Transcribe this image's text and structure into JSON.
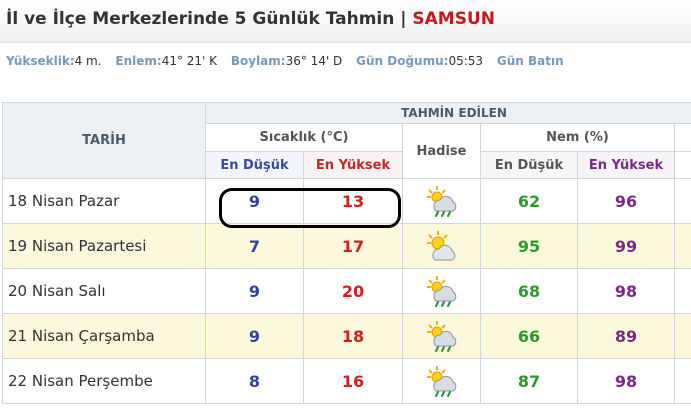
{
  "header": {
    "title": "İl ve İlçe Merkezlerinde 5 Günlük Tahmin |",
    "city": "SAMSUN"
  },
  "info": {
    "elevation_label": "Yükseklik:",
    "elevation_value": "4 m.",
    "lat_label": "Enlem:",
    "lat_value": "41° 21' K",
    "lon_label": "Boylam:",
    "lon_value": "36° 14' D",
    "sunrise_label": "Gün Doğumu:",
    "sunrise_value": "05:53",
    "sunset_label": "Gün Batın"
  },
  "table": {
    "date_header": "TARİH",
    "forecast_header": "TAHMİN EDİLEN",
    "temp_header": "Sıcaklık (°C)",
    "event_header": "Hadise",
    "humidity_header": "Nem (%)",
    "low_header": "En Düşük",
    "high_header": "En Yüksek",
    "hum_low_header": "En Düşük",
    "hum_high_header": "En Yüksek",
    "rows": [
      {
        "date": "18 Nisan Pazar",
        "temp_low": "9",
        "temp_high": "13",
        "icon": "cloud-sun-rain-icon",
        "hum_low": "62",
        "hum_high": "96"
      },
      {
        "date": "19 Nisan Pazartesi",
        "temp_low": "7",
        "temp_high": "17",
        "icon": "partly-cloudy-icon",
        "hum_low": "95",
        "hum_high": "99"
      },
      {
        "date": "20 Nisan Salı",
        "temp_low": "9",
        "temp_high": "20",
        "icon": "cloud-sun-rain-icon",
        "hum_low": "68",
        "hum_high": "98"
      },
      {
        "date": "21 Nisan Çarşamba",
        "temp_low": "9",
        "temp_high": "18",
        "icon": "cloud-sun-rain-icon",
        "hum_low": "66",
        "hum_high": "89"
      },
      {
        "date": "22 Nisan Perşembe",
        "temp_low": "8",
        "temp_high": "16",
        "icon": "cloud-sun-rain-icon",
        "hum_low": "87",
        "hum_high": "98"
      }
    ]
  }
}
